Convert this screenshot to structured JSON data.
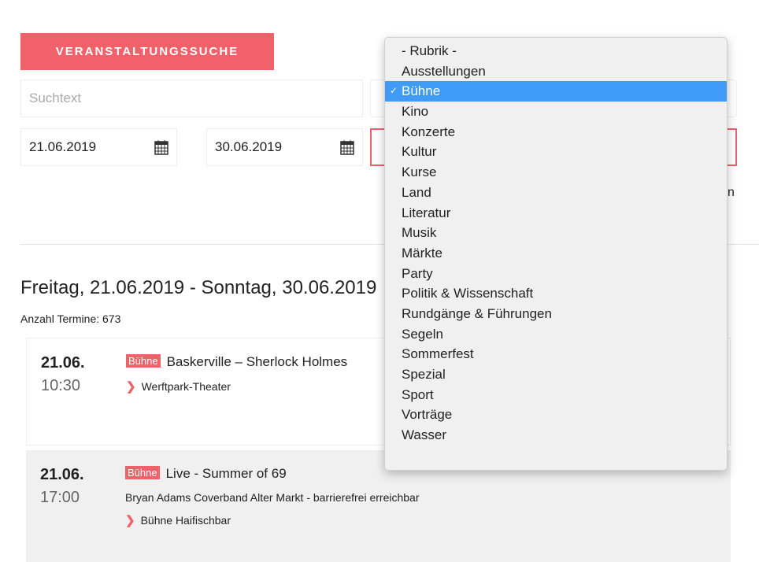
{
  "search": {
    "title": "VERANSTALTUNGSSUCHE",
    "text_placeholder": "Suchtext",
    "date_from": "21.06.2019",
    "date_to": "30.06.2019",
    "hidden_fragment": "n"
  },
  "results": {
    "heading": "Freitag, 21.06.2019 - Sonntag, 30.06.2019",
    "count": "Anzahl Termine: 673",
    "events": [
      {
        "date": "21.06.",
        "time": "10:30",
        "category": "Bühne",
        "title": "Baskerville – Sherlock Holmes",
        "description": "",
        "location": "Werftpark-Theater"
      },
      {
        "date": "21.06.",
        "time": "17:00",
        "category": "Bühne",
        "title": "Live - Summer of 69",
        "description": "Bryan Adams Coverband Alter Markt - barrierefrei erreichbar",
        "location": "Bühne Haifischbar"
      }
    ]
  },
  "dropdown": {
    "selected": "Bühne",
    "options": [
      "- Rubrik -",
      "Ausstellungen",
      "Bühne",
      "Kino",
      "Konzerte",
      "Kultur",
      "Kurse",
      "Land",
      "Literatur",
      "Musik",
      "Märkte",
      "Party",
      "Politik & Wissenschaft",
      "Rundgänge & Führungen",
      "Segeln",
      "Sommerfest",
      "Spezial",
      "Sport",
      "Vorträge",
      "Wasser"
    ]
  },
  "colors": {
    "accent": "#f0616a",
    "selection": "#3f9bf5"
  }
}
